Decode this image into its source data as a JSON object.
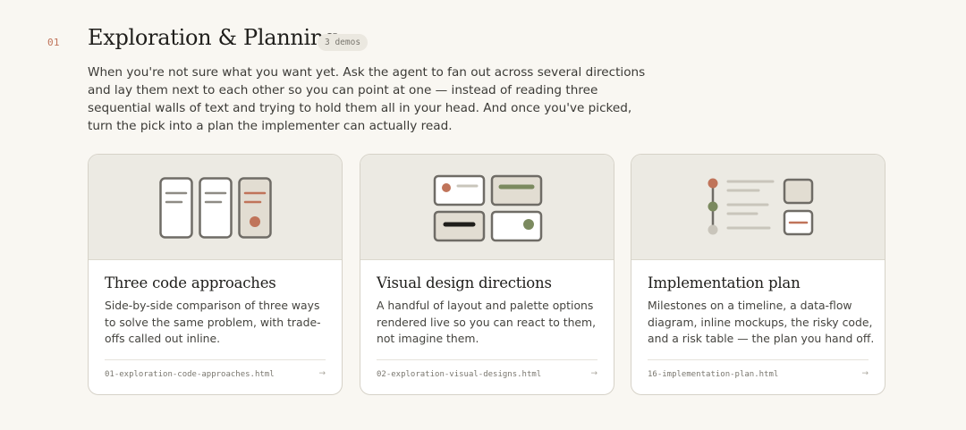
{
  "section": {
    "number": "01",
    "title": "Exploration & Planning",
    "badge": "3 demos",
    "intro": "When you're not sure what you want yet. Ask the agent to fan out across several directions and lay them next to each other so you can point at one — instead of reading three sequential walls of text and trying to hold them all in your head. And once you've picked, turn the pick into a plan the implementer can actually read."
  },
  "cards": [
    {
      "title": "Three code approaches",
      "description": "Side-by-side comparison of three ways to solve the same problem, with trade-offs called out inline.",
      "file": "01-exploration-code-approaches.html",
      "arrow": "→",
      "thumbnail_icon": "three-columns-icon"
    },
    {
      "title": "Visual design directions",
      "description": "A handful of layout and palette options rendered live so you can react to them, not imagine them.",
      "file": "02-exploration-visual-designs.html",
      "arrow": "→",
      "thumbnail_icon": "design-grid-icon"
    },
    {
      "title": "Implementation plan",
      "description": "Milestones on a timeline, a data-flow diagram, inline mockups, the risky code, and a risk table — the plan you hand off.",
      "file": "16-implementation-plan.html",
      "arrow": "→",
      "thumbnail_icon": "timeline-icon"
    }
  ],
  "colors": {
    "accent": "#c0745a",
    "green": "#7b8a5f",
    "background": "#f9f7f2",
    "thumb_bg": "#eceae3",
    "outline": "#6f6c66"
  }
}
